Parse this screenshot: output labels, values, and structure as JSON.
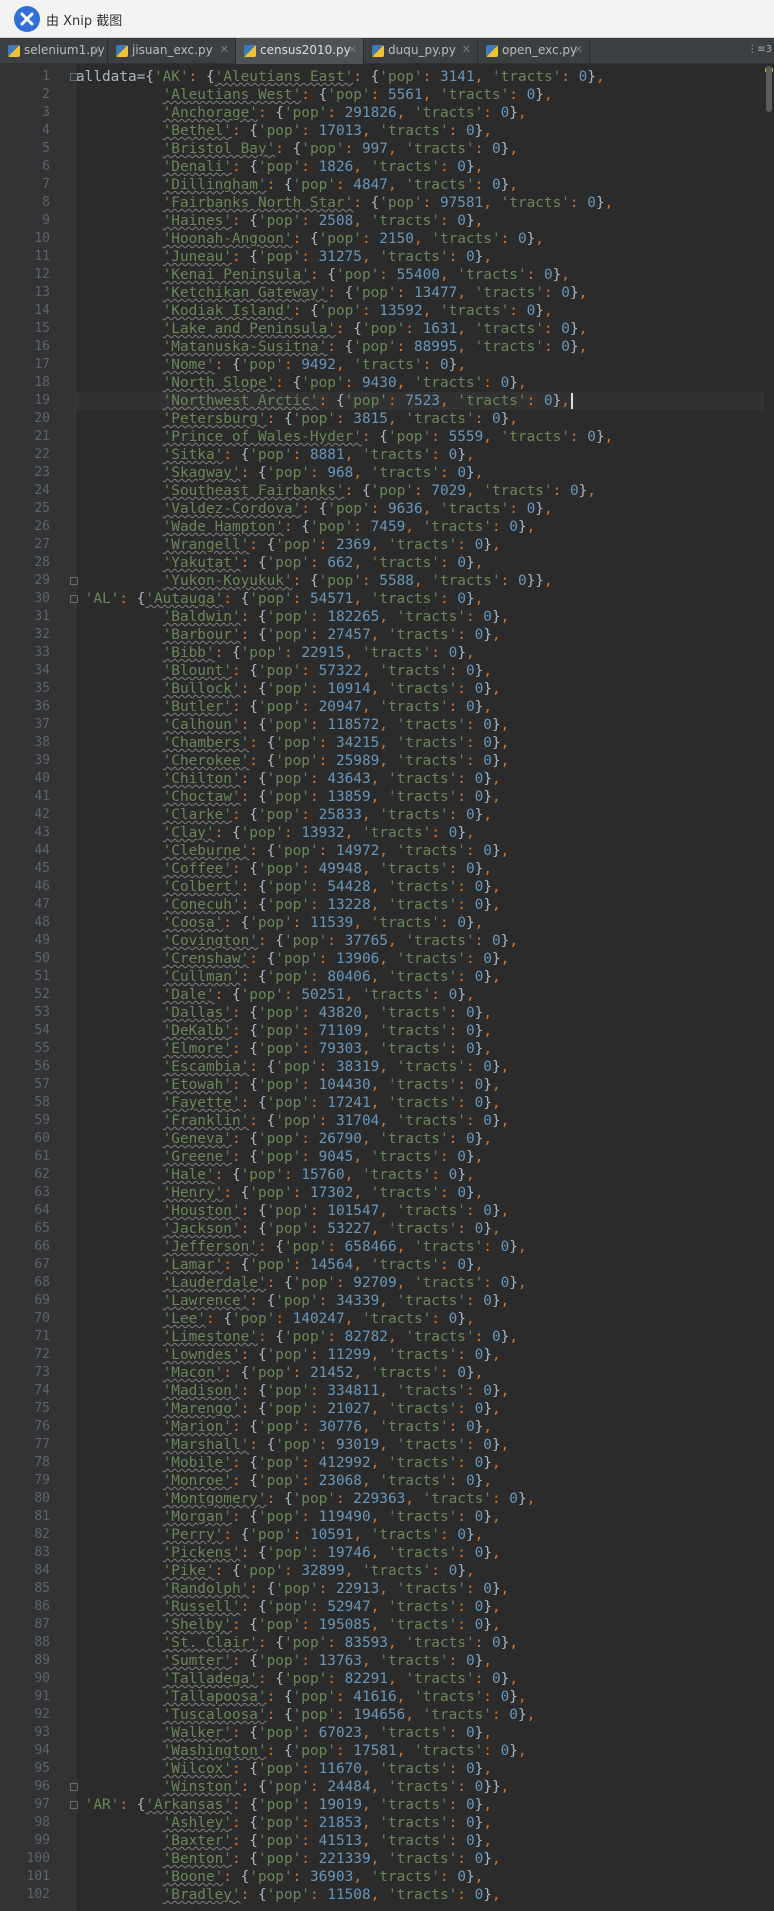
{
  "window": {
    "title": "由 Xnip 截图"
  },
  "tabs": [
    {
      "label": "selenium1.py",
      "active": false
    },
    {
      "label": "jisuan_exc.py",
      "active": false
    },
    {
      "label": "census2010.py",
      "active": true
    },
    {
      "label": "duqu_py.py",
      "active": false
    },
    {
      "label": "open_exc.py",
      "active": false
    }
  ],
  "tab_overflow": "⋮≡3",
  "editor": {
    "current_line": 19,
    "colors": {
      "background": "#2b2b2b",
      "string": "#6a8759",
      "number": "#6897bb",
      "keyword_punctuation": "#cc7832",
      "text": "#a9b7c6"
    },
    "lines": [
      {
        "n": "1",
        "code": "alldata={'AK': {'Aleutians East': {'pop': 3141, 'tracts': 0},"
      },
      {
        "n": "2",
        "code": "          'Aleutians West': {'pop': 5561, 'tracts': 0},"
      },
      {
        "n": "3",
        "code": "          'Anchorage': {'pop': 291826, 'tracts': 0},"
      },
      {
        "n": "4",
        "code": "          'Bethel': {'pop': 17013, 'tracts': 0},"
      },
      {
        "n": "5",
        "code": "          'Bristol Bay': {'pop': 997, 'tracts': 0},"
      },
      {
        "n": "6",
        "code": "          'Denali': {'pop': 1826, 'tracts': 0},"
      },
      {
        "n": "7",
        "code": "          'Dillingham': {'pop': 4847, 'tracts': 0},"
      },
      {
        "n": "8",
        "code": "          'Fairbanks North Star': {'pop': 97581, 'tracts': 0},"
      },
      {
        "n": "9",
        "code": "          'Haines': {'pop': 2508, 'tracts': 0},"
      },
      {
        "n": "10",
        "code": "          'Hoonah-Angoon': {'pop': 2150, 'tracts': 0},"
      },
      {
        "n": "11",
        "code": "          'Juneau': {'pop': 31275, 'tracts': 0},"
      },
      {
        "n": "12",
        "code": "          'Kenai Peninsula': {'pop': 55400, 'tracts': 0},"
      },
      {
        "n": "13",
        "code": "          'Ketchikan Gateway': {'pop': 13477, 'tracts': 0},"
      },
      {
        "n": "14",
        "code": "          'Kodiak Island': {'pop': 13592, 'tracts': 0},"
      },
      {
        "n": "15",
        "code": "          'Lake and Peninsula': {'pop': 1631, 'tracts': 0},"
      },
      {
        "n": "16",
        "code": "          'Matanuska-Susitna': {'pop': 88995, 'tracts': 0},"
      },
      {
        "n": "17",
        "code": "          'Nome': {'pop': 9492, 'tracts': 0},"
      },
      {
        "n": "18",
        "code": "          'North Slope': {'pop': 9430, 'tracts': 0},"
      },
      {
        "n": "19",
        "code": "          'Northwest Arctic': {'pop': 7523, 'tracts': 0},"
      },
      {
        "n": "20",
        "code": "          'Petersburg': {'pop': 3815, 'tracts': 0},"
      },
      {
        "n": "21",
        "code": "          'Prince of Wales-Hyder': {'pop': 5559, 'tracts': 0},"
      },
      {
        "n": "22",
        "code": "          'Sitka': {'pop': 8881, 'tracts': 0},"
      },
      {
        "n": "23",
        "code": "          'Skagway': {'pop': 968, 'tracts': 0},"
      },
      {
        "n": "24",
        "code": "          'Southeast Fairbanks': {'pop': 7029, 'tracts': 0},"
      },
      {
        "n": "25",
        "code": "          'Valdez-Cordova': {'pop': 9636, 'tracts': 0},"
      },
      {
        "n": "26",
        "code": "          'Wade Hampton': {'pop': 7459, 'tracts': 0},"
      },
      {
        "n": "27",
        "code": "          'Wrangell': {'pop': 2369, 'tracts': 0},"
      },
      {
        "n": "28",
        "code": "          'Yakutat': {'pop': 662, 'tracts': 0},"
      },
      {
        "n": "29",
        "code": "          'Yukon-Koyukuk': {'pop': 5588, 'tracts': 0}},"
      },
      {
        "n": "30",
        "code": " 'AL': {'Autauga': {'pop': 54571, 'tracts': 0},"
      },
      {
        "n": "31",
        "code": "          'Baldwin': {'pop': 182265, 'tracts': 0},"
      },
      {
        "n": "32",
        "code": "          'Barbour': {'pop': 27457, 'tracts': 0},"
      },
      {
        "n": "33",
        "code": "          'Bibb': {'pop': 22915, 'tracts': 0},"
      },
      {
        "n": "34",
        "code": "          'Blount': {'pop': 57322, 'tracts': 0},"
      },
      {
        "n": "35",
        "code": "          'Bullock': {'pop': 10914, 'tracts': 0},"
      },
      {
        "n": "36",
        "code": "          'Butler': {'pop': 20947, 'tracts': 0},"
      },
      {
        "n": "37",
        "code": "          'Calhoun': {'pop': 118572, 'tracts': 0},"
      },
      {
        "n": "38",
        "code": "          'Chambers': {'pop': 34215, 'tracts': 0},"
      },
      {
        "n": "39",
        "code": "          'Cherokee': {'pop': 25989, 'tracts': 0},"
      },
      {
        "n": "40",
        "code": "          'Chilton': {'pop': 43643, 'tracts': 0},"
      },
      {
        "n": "41",
        "code": "          'Choctaw': {'pop': 13859, 'tracts': 0},"
      },
      {
        "n": "42",
        "code": "          'Clarke': {'pop': 25833, 'tracts': 0},"
      },
      {
        "n": "43",
        "code": "          'Clay': {'pop': 13932, 'tracts': 0},"
      },
      {
        "n": "44",
        "code": "          'Cleburne': {'pop': 14972, 'tracts': 0},"
      },
      {
        "n": "45",
        "code": "          'Coffee': {'pop': 49948, 'tracts': 0},"
      },
      {
        "n": "46",
        "code": "          'Colbert': {'pop': 54428, 'tracts': 0},"
      },
      {
        "n": "47",
        "code": "          'Conecuh': {'pop': 13228, 'tracts': 0},"
      },
      {
        "n": "48",
        "code": "          'Coosa': {'pop': 11539, 'tracts': 0},"
      },
      {
        "n": "49",
        "code": "          'Covington': {'pop': 37765, 'tracts': 0},"
      },
      {
        "n": "50",
        "code": "          'Crenshaw': {'pop': 13906, 'tracts': 0},"
      },
      {
        "n": "51",
        "code": "          'Cullman': {'pop': 80406, 'tracts': 0},"
      },
      {
        "n": "52",
        "code": "          'Dale': {'pop': 50251, 'tracts': 0},"
      },
      {
        "n": "53",
        "code": "          'Dallas': {'pop': 43820, 'tracts': 0},"
      },
      {
        "n": "54",
        "code": "          'DeKalb': {'pop': 71109, 'tracts': 0},"
      },
      {
        "n": "55",
        "code": "          'Elmore': {'pop': 79303, 'tracts': 0},"
      },
      {
        "n": "56",
        "code": "          'Escambia': {'pop': 38319, 'tracts': 0},"
      },
      {
        "n": "57",
        "code": "          'Etowah': {'pop': 104430, 'tracts': 0},"
      },
      {
        "n": "58",
        "code": "          'Fayette': {'pop': 17241, 'tracts': 0},"
      },
      {
        "n": "59",
        "code": "          'Franklin': {'pop': 31704, 'tracts': 0},"
      },
      {
        "n": "60",
        "code": "          'Geneva': {'pop': 26790, 'tracts': 0},"
      },
      {
        "n": "61",
        "code": "          'Greene': {'pop': 9045, 'tracts': 0},"
      },
      {
        "n": "62",
        "code": "          'Hale': {'pop': 15760, 'tracts': 0},"
      },
      {
        "n": "63",
        "code": "          'Henry': {'pop': 17302, 'tracts': 0},"
      },
      {
        "n": "64",
        "code": "          'Houston': {'pop': 101547, 'tracts': 0},"
      },
      {
        "n": "65",
        "code": "          'Jackson': {'pop': 53227, 'tracts': 0},"
      },
      {
        "n": "66",
        "code": "          'Jefferson': {'pop': 658466, 'tracts': 0},"
      },
      {
        "n": "67",
        "code": "          'Lamar': {'pop': 14564, 'tracts': 0},"
      },
      {
        "n": "68",
        "code": "          'Lauderdale': {'pop': 92709, 'tracts': 0},"
      },
      {
        "n": "69",
        "code": "          'Lawrence': {'pop': 34339, 'tracts': 0},"
      },
      {
        "n": "70",
        "code": "          'Lee': {'pop': 140247, 'tracts': 0},"
      },
      {
        "n": "71",
        "code": "          'Limestone': {'pop': 82782, 'tracts': 0},"
      },
      {
        "n": "72",
        "code": "          'Lowndes': {'pop': 11299, 'tracts': 0},"
      },
      {
        "n": "73",
        "code": "          'Macon': {'pop': 21452, 'tracts': 0},"
      },
      {
        "n": "74",
        "code": "          'Madison': {'pop': 334811, 'tracts': 0},"
      },
      {
        "n": "75",
        "code": "          'Marengo': {'pop': 21027, 'tracts': 0},"
      },
      {
        "n": "76",
        "code": "          'Marion': {'pop': 30776, 'tracts': 0},"
      },
      {
        "n": "77",
        "code": "          'Marshall': {'pop': 93019, 'tracts': 0},"
      },
      {
        "n": "78",
        "code": "          'Mobile': {'pop': 412992, 'tracts': 0},"
      },
      {
        "n": "79",
        "code": "          'Monroe': {'pop': 23068, 'tracts': 0},"
      },
      {
        "n": "80",
        "code": "          'Montgomery': {'pop': 229363, 'tracts': 0},"
      },
      {
        "n": "81",
        "code": "          'Morgan': {'pop': 119490, 'tracts': 0},"
      },
      {
        "n": "82",
        "code": "          'Perry': {'pop': 10591, 'tracts': 0},"
      },
      {
        "n": "83",
        "code": "          'Pickens': {'pop': 19746, 'tracts': 0},"
      },
      {
        "n": "84",
        "code": "          'Pike': {'pop': 32899, 'tracts': 0},"
      },
      {
        "n": "85",
        "code": "          'Randolph': {'pop': 22913, 'tracts': 0},"
      },
      {
        "n": "86",
        "code": "          'Russell': {'pop': 52947, 'tracts': 0},"
      },
      {
        "n": "87",
        "code": "          'Shelby': {'pop': 195085, 'tracts': 0},"
      },
      {
        "n": "88",
        "code": "          'St. Clair': {'pop': 83593, 'tracts': 0},"
      },
      {
        "n": "89",
        "code": "          'Sumter': {'pop': 13763, 'tracts': 0},"
      },
      {
        "n": "90",
        "code": "          'Talladega': {'pop': 82291, 'tracts': 0},"
      },
      {
        "n": "91",
        "code": "          'Tallapoosa': {'pop': 41616, 'tracts': 0},"
      },
      {
        "n": "92",
        "code": "          'Tuscaloosa': {'pop': 194656, 'tracts': 0},"
      },
      {
        "n": "93",
        "code": "          'Walker': {'pop': 67023, 'tracts': 0},"
      },
      {
        "n": "94",
        "code": "          'Washington': {'pop': 17581, 'tracts': 0},"
      },
      {
        "n": "95",
        "code": "          'Wilcox': {'pop': 11670, 'tracts': 0},"
      },
      {
        "n": "96",
        "code": "          'Winston': {'pop': 24484, 'tracts': 0}},"
      },
      {
        "n": "97",
        "code": " 'AR': {'Arkansas': {'pop': 19019, 'tracts': 0},"
      },
      {
        "n": "98",
        "code": "          'Ashley': {'pop': 21853, 'tracts': 0},"
      },
      {
        "n": "99",
        "code": "          'Baxter': {'pop': 41513, 'tracts': 0},"
      },
      {
        "n": "100",
        "code": "          'Benton': {'pop': 221339, 'tracts': 0},"
      },
      {
        "n": "101",
        "code": "          'Boone': {'pop': 36903, 'tracts': 0},"
      },
      {
        "n": "102",
        "code": "          'Bradley': {'pop': 11508, 'tracts': 0},"
      }
    ]
  }
}
